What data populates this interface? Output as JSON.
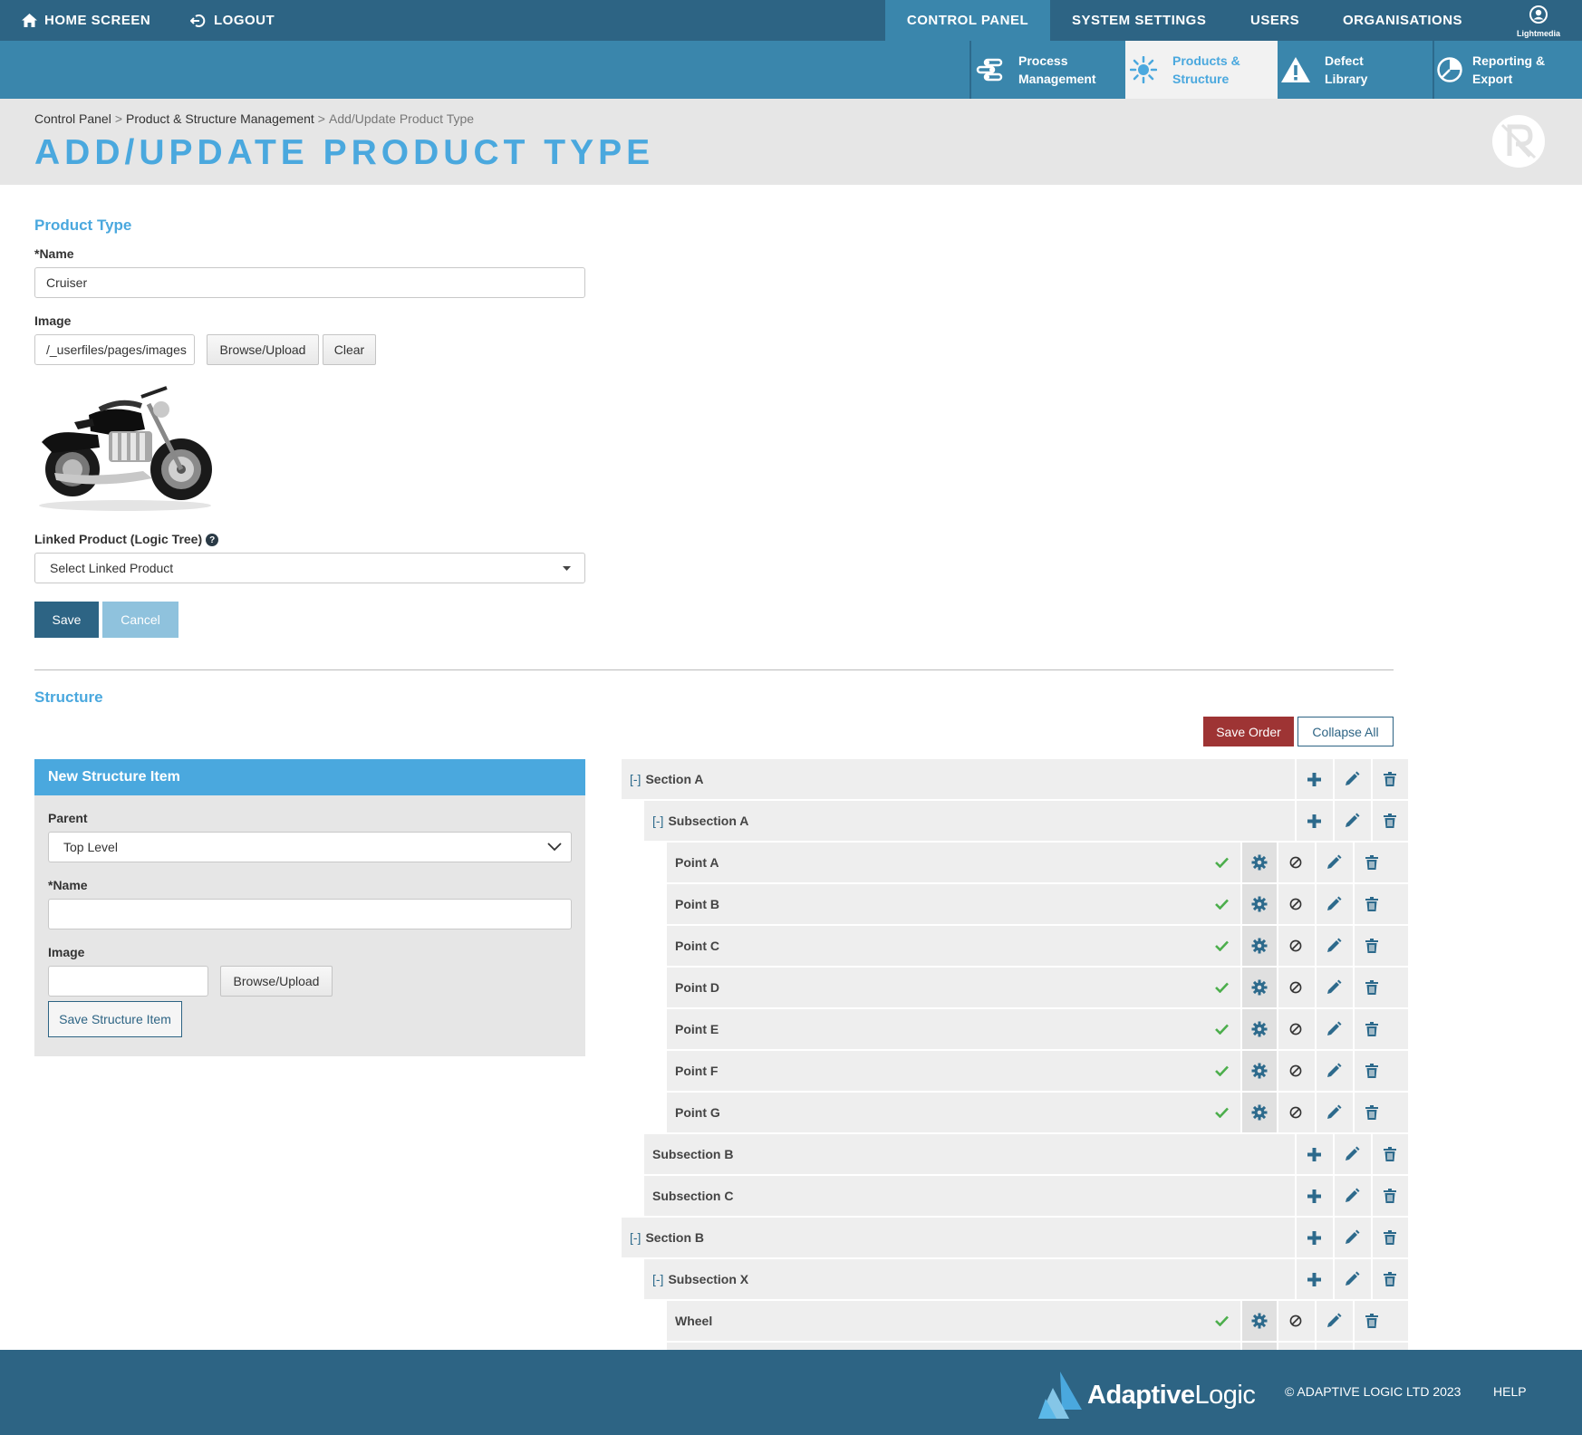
{
  "topnav": {
    "home": "HOME SCREEN",
    "logout": "LOGOUT",
    "control_panel": "CONTROL PANEL",
    "system_settings": "SYSTEM SETTINGS",
    "users": "USERS",
    "organisations": "ORGANISATIONS",
    "user_label": "Lightmedia"
  },
  "subnav": [
    {
      "line1": "Process",
      "line2": "Management",
      "icon": "process-icon"
    },
    {
      "line1": "Products &",
      "line2": "Structure",
      "icon": "sun-icon",
      "active": true
    },
    {
      "line1": "Defect",
      "line2": "Library",
      "icon": "warning-icon"
    },
    {
      "line1": "Reporting &",
      "line2": "Export",
      "icon": "pie-chart-icon"
    }
  ],
  "breadcrumb": {
    "items": [
      "Control Panel",
      "Product & Structure Management",
      "Add/Update Product Type"
    ],
    "separator": ">"
  },
  "page_title": "ADD/UPDATE PRODUCT TYPE",
  "form": {
    "section_title": "Product Type",
    "name_label": "*Name",
    "name_value": "Cruiser",
    "image_label": "Image",
    "image_value": "/_userfiles/pages/images",
    "browse_label": "Browse/Upload",
    "clear_label": "Clear",
    "linked_label": "Linked Product (Logic Tree)",
    "linked_help": "?",
    "linked_value": "Select Linked Product",
    "save_label": "Save",
    "cancel_label": "Cancel"
  },
  "structure": {
    "title": "Structure",
    "save_order_label": "Save Order",
    "collapse_all_label": "Collapse All"
  },
  "new_item": {
    "heading": "New Structure Item",
    "parent_label": "Parent",
    "parent_value": "Top Level",
    "name_label": "*Name",
    "name_value": "",
    "image_label": "Image",
    "image_value": "",
    "browse_label": "Browse/Upload",
    "save_label": "Save Structure Item"
  },
  "tree": [
    {
      "label": "Section A",
      "level": 0,
      "kind": "section",
      "toggle": "[-]"
    },
    {
      "label": "Subsection A",
      "level": 1,
      "kind": "section",
      "toggle": "[-]"
    },
    {
      "label": "Point A",
      "level": 2,
      "kind": "point"
    },
    {
      "label": "Point B",
      "level": 2,
      "kind": "point"
    },
    {
      "label": "Point C",
      "level": 2,
      "kind": "point"
    },
    {
      "label": "Point D",
      "level": 2,
      "kind": "point"
    },
    {
      "label": "Point E",
      "level": 2,
      "kind": "point"
    },
    {
      "label": "Point F",
      "level": 2,
      "kind": "point"
    },
    {
      "label": "Point G",
      "level": 2,
      "kind": "point"
    },
    {
      "label": "Subsection B",
      "level": 1,
      "kind": "section",
      "toggle": ""
    },
    {
      "label": "Subsection C",
      "level": 1,
      "kind": "section",
      "toggle": ""
    },
    {
      "label": "Section B",
      "level": 0,
      "kind": "section",
      "toggle": "[-]"
    },
    {
      "label": "Subsection X",
      "level": 1,
      "kind": "section",
      "toggle": "[-]"
    },
    {
      "label": "Wheel",
      "level": 2,
      "kind": "point"
    },
    {
      "label": "",
      "level": 2,
      "kind": "point"
    }
  ],
  "footer": {
    "brand_bold": "Adaptive",
    "brand_light": "Logic",
    "copyright": "© ADAPTIVE LOGIC LTD 2023",
    "help": "HELP"
  },
  "colors": {
    "nav_dark": "#2d6484",
    "nav_light": "#3a86ac",
    "accent": "#4aa8de",
    "danger": "#9e3434",
    "success": "#4cae4c"
  }
}
